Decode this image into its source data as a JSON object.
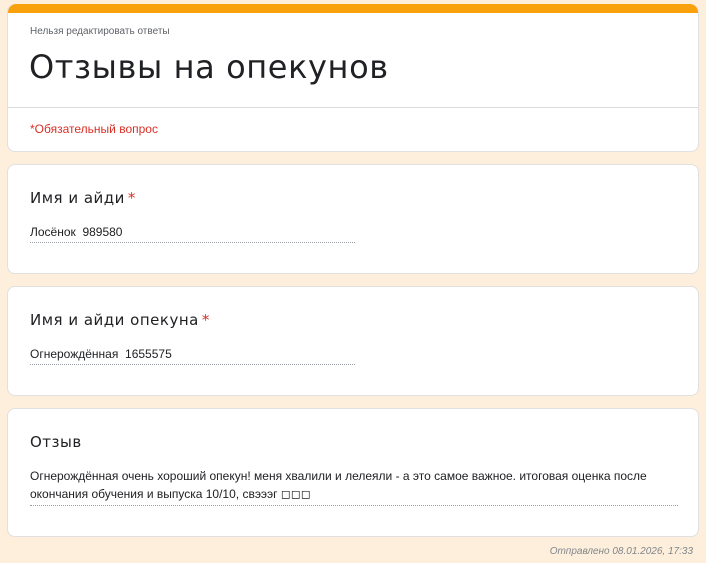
{
  "form": {
    "notice": "Нельзя редактировать ответы",
    "title": "Отзывы на опекунов",
    "required_note": "*Обязательный вопрос",
    "accent_color": "#f9a10d",
    "required_color": "#d93025"
  },
  "questions": [
    {
      "title": "Имя и айди",
      "required_mark": "*",
      "answer": "Лосёнок  989580"
    },
    {
      "title": "Имя и айди опекуна",
      "required_mark": "*",
      "answer": "Огнерождённая  1655575"
    },
    {
      "title": "Отзыв",
      "answer": "Огнерождённая очень хороший опекун! меня хвалили и лелеяли - а это самое важное. итоговая оценка после окончания обучения и выпуска 10/10, свэээг ◻◻◻"
    }
  ],
  "footer": {
    "submitted": "Отправлено 08.01.2026, 17:33"
  }
}
